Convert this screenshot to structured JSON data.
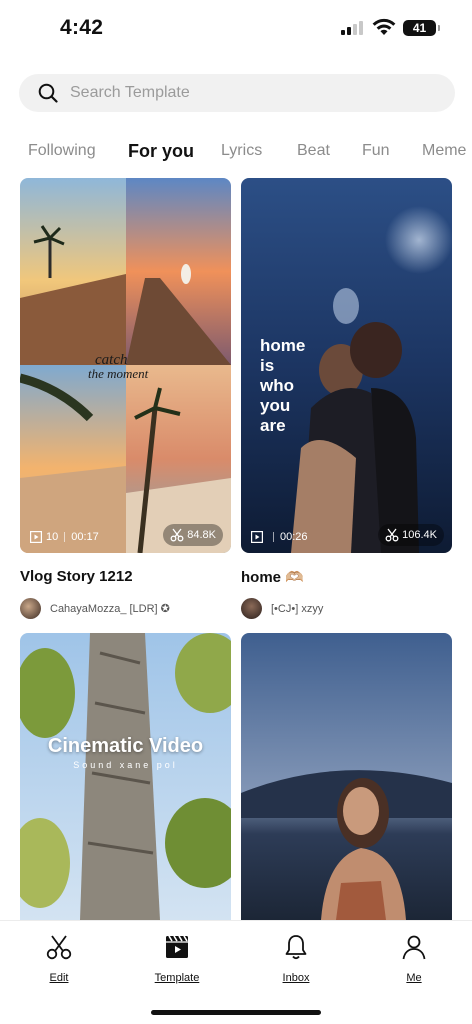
{
  "status_bar": {
    "time": "4:42",
    "battery": "41"
  },
  "search": {
    "placeholder": "Search Template"
  },
  "tabs": [
    {
      "label": "Following"
    },
    {
      "label": "For you",
      "active": true
    },
    {
      "label": "Lyrics"
    },
    {
      "label": "Beat"
    },
    {
      "label": "Fun"
    },
    {
      "label": "Meme"
    }
  ],
  "cards": [
    {
      "title": "Vlog Story 1212",
      "author": "CahayaMozza_ [LDR] ✪",
      "clips": "10",
      "duration": "00:17",
      "uses": "84.8K",
      "overlay_text": "catch the moment"
    },
    {
      "title": "home 🫶🏼",
      "author": "[•CJ•] xzyy",
      "clips": "",
      "duration": "00:26",
      "uses": "106.4K",
      "overlay_text": "home\nis\nwho\nyou\nare"
    },
    {
      "title": "",
      "author": "",
      "overlay_title": "Cinematic Video",
      "overlay_sub": "Sound xane pol"
    },
    {
      "title": "",
      "author": ""
    }
  ],
  "bottom_nav": {
    "items": [
      {
        "label": "Edit",
        "icon": "scissors-icon"
      },
      {
        "label": "Template",
        "icon": "clapperboard-icon"
      },
      {
        "label": "Inbox",
        "icon": "bell-icon"
      },
      {
        "label": "Me",
        "icon": "person-icon"
      }
    ]
  }
}
